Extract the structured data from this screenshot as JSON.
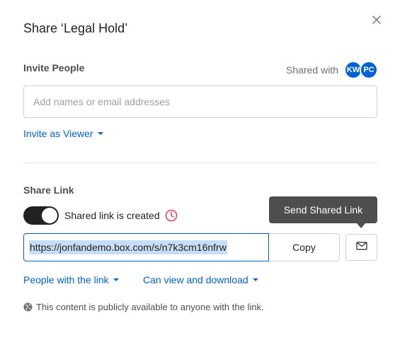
{
  "dialog": {
    "title": "Share ‘Legal Hold’",
    "close_icon": "close-icon"
  },
  "invite": {
    "label": "Invite People",
    "shared_with_label": "Shared with",
    "avatars": [
      "KW",
      "PC"
    ],
    "placeholder": "Add names or email addresses",
    "value": "",
    "permission_label": "Invite as Viewer"
  },
  "share_link": {
    "label": "Share Link",
    "toggle_on": true,
    "toggle_label": "Shared link is created",
    "expiration_icon": "clock-icon",
    "url": "https://jonfandemo.box.com/s/n7k3cm16nfrw",
    "copy_label": "Copy",
    "email_icon": "envelope-icon",
    "tooltip": "Send Shared Link",
    "access_label": "People with the link",
    "permission_label": "Can view and download",
    "notice_icon": "globe-icon",
    "notice": "This content is publicly available to anyone with the link."
  },
  "colors": {
    "accent": "#0061d5",
    "tooltip_bg": "#4e4e4e",
    "toggle_on": "#222222",
    "clock": "#ed3757",
    "selection": "#c8ddf7"
  }
}
